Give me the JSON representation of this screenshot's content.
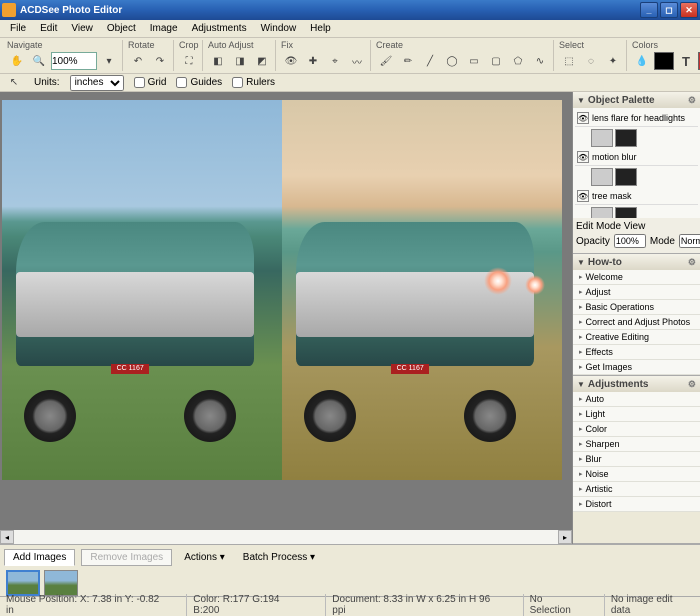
{
  "title": "ACDSee Photo Editor",
  "menu": [
    "File",
    "Edit",
    "View",
    "Object",
    "Image",
    "Adjustments",
    "Window",
    "Help"
  ],
  "toolbar": {
    "navigate": "Navigate",
    "zoom_value": "100%",
    "rotate": "Rotate",
    "crop": "Crop",
    "auto_adjust": "Auto Adjust",
    "fix": "Fix",
    "create": "Create",
    "select": "Select",
    "colors": "Colors"
  },
  "ruler": {
    "units_label": "Units:",
    "units_value": "inches",
    "grid": "Grid",
    "guides": "Guides",
    "rulers": "Rulers"
  },
  "objects_panel": {
    "title": "Object Palette",
    "items": [
      {
        "name": "lens flare for headlights"
      },
      {
        "name": "motion blur"
      },
      {
        "name": "tree mask"
      }
    ],
    "edit_mode": "Edit Mode View",
    "opacity_label": "Opacity",
    "opacity_value": "100%",
    "mode_label": "Mode",
    "mode_value": "Normal"
  },
  "howto_panel": {
    "title": "How-to",
    "items": [
      "Welcome",
      "Adjust",
      "Basic Operations",
      "Correct and Adjust Photos",
      "Creative Editing",
      "Effects",
      "Get Images"
    ]
  },
  "adjustments_panel": {
    "title": "Adjustments",
    "items": [
      "Auto",
      "Light",
      "Color",
      "Sharpen",
      "Blur",
      "Noise",
      "Artistic",
      "Distort"
    ]
  },
  "bottom": {
    "add_images": "Add Images",
    "remove_images": "Remove Images",
    "actions": "Actions",
    "batch": "Batch Process"
  },
  "status": {
    "mouse": "Mouse Position: X: 7.38 in    Y: -0.82 in",
    "color": "Color:  R:177  G:194  B:200",
    "document": "Document: 8.33 in W x 6.25 in H    96 ppi",
    "selection": "No Selection",
    "edit": "No image edit data"
  }
}
